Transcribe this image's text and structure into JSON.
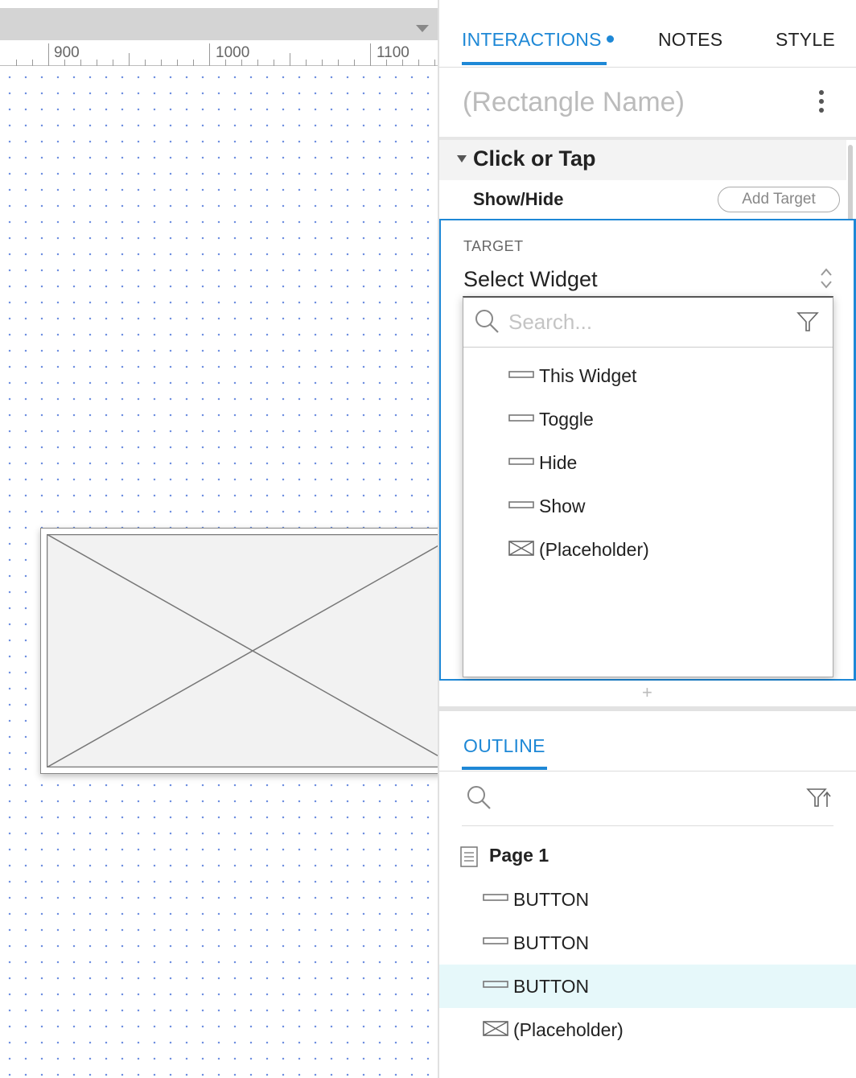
{
  "ruler": {
    "labels": [
      "900",
      "1000",
      "1100"
    ]
  },
  "tabs": {
    "interactions": "INTERACTIONS",
    "notes": "NOTES",
    "style": "STYLE"
  },
  "widget": {
    "name_placeholder": "(Rectangle Name)"
  },
  "event": {
    "title": "Click or Tap",
    "action": "Show/Hide",
    "add_target_label": "Add Target"
  },
  "target": {
    "label": "TARGET",
    "selected": "Select Widget",
    "search_placeholder": "Search...",
    "options": [
      {
        "label": "This Widget",
        "icon": "button-widget-icon"
      },
      {
        "label": "Toggle",
        "icon": "button-widget-icon"
      },
      {
        "label": "Hide",
        "icon": "button-widget-icon"
      },
      {
        "label": "Show",
        "icon": "button-widget-icon"
      },
      {
        "label": "(Placeholder)",
        "icon": "placeholder-widget-icon"
      }
    ]
  },
  "outline": {
    "tab_label": "OUTLINE",
    "page_label": "Page 1",
    "items": [
      {
        "label": "BUTTON",
        "icon": "button-widget-icon",
        "selected": false
      },
      {
        "label": "BUTTON",
        "icon": "button-widget-icon",
        "selected": false
      },
      {
        "label": "BUTTON",
        "icon": "button-widget-icon",
        "selected": true
      },
      {
        "label": "(Placeholder)",
        "icon": "placeholder-widget-icon",
        "selected": false
      }
    ]
  },
  "colors": {
    "accent": "#1e88d6",
    "selected_row": "#e6f8fa",
    "grid_dot": "#6f8fe0"
  }
}
